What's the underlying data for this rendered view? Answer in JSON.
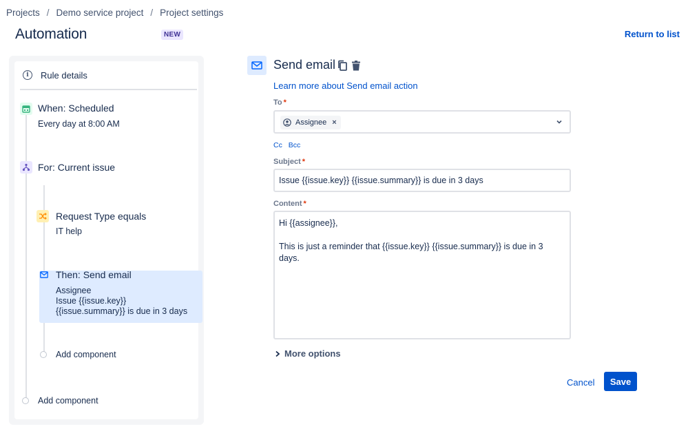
{
  "breadcrumb": {
    "items": [
      "Projects",
      "Demo service project",
      "Project settings"
    ],
    "separator": "/"
  },
  "header": {
    "title": "Automation",
    "badge": "NEW",
    "return_link": "Return to list"
  },
  "rule": {
    "details_label": "Rule details",
    "trigger": {
      "title": "When: Scheduled",
      "subtitle": "Every day at 8:00 AM",
      "icon": "calendar-icon",
      "color": "#36b37e"
    },
    "branch": {
      "title": "For: Current issue",
      "icon": "branch-icon",
      "color": "#6554c0"
    },
    "condition": {
      "title": "Request Type equals",
      "subtitle": "IT help",
      "icon": "shuffle-icon",
      "color": "#ff8b00"
    },
    "action": {
      "title": "Then: Send email",
      "lines": [
        "Assignee",
        "Issue {{issue.key}}",
        "{{issue.summary}} is due in 3 days"
      ],
      "icon": "email-icon",
      "color": "#0065ff"
    },
    "add_inner": "Add component",
    "add_outer": "Add component"
  },
  "form": {
    "action_title": "Send email",
    "learn_more": "Learn more about Send email action",
    "to_label": "To",
    "to_chip": "Assignee",
    "cc_label": "Cc",
    "bcc_label": "Bcc",
    "subject_label": "Subject",
    "subject_value": "Issue {{issue.key}} {{issue.summary}} is due in 3 days",
    "content_label": "Content",
    "content_value": "Hi {{assignee}},\n\nThis is just a reminder that {{issue.key}} {{issue.summary}} is due in 3\ndays.",
    "more_options": "More options",
    "cancel_label": "Cancel",
    "save_label": "Save",
    "required_mark": "*"
  }
}
